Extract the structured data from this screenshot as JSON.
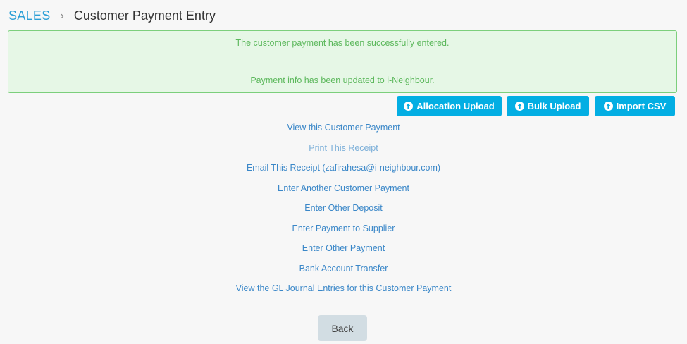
{
  "breadcrumb": {
    "root": "SALES",
    "separator": "›",
    "current": "Customer Payment Entry"
  },
  "alert": {
    "line1": "The customer payment has been successfully entered.",
    "line2": "Payment info has been updated to i-Neighbour."
  },
  "buttons": {
    "allocation_upload": "Allocation Upload",
    "bulk_upload": "Bulk Upload",
    "import_csv": "Import CSV"
  },
  "links": [
    "View this Customer Payment",
    "Print This Receipt",
    "Email This Receipt (zafirahesa@i-neighbour.com)",
    "Enter Another Customer Payment",
    "Enter Other Deposit",
    "Enter Payment to Supplier",
    "Enter Other Payment",
    "Bank Account Transfer",
    "View the GL Journal Entries for this Customer Payment"
  ],
  "back_label": "Back",
  "colors": {
    "accent": "#03aee3",
    "success_bg": "#e6f7e6",
    "success_text": "#5cb85c",
    "link": "#3a87c8"
  },
  "icons": {
    "button_icon": "upload-circle-icon"
  }
}
